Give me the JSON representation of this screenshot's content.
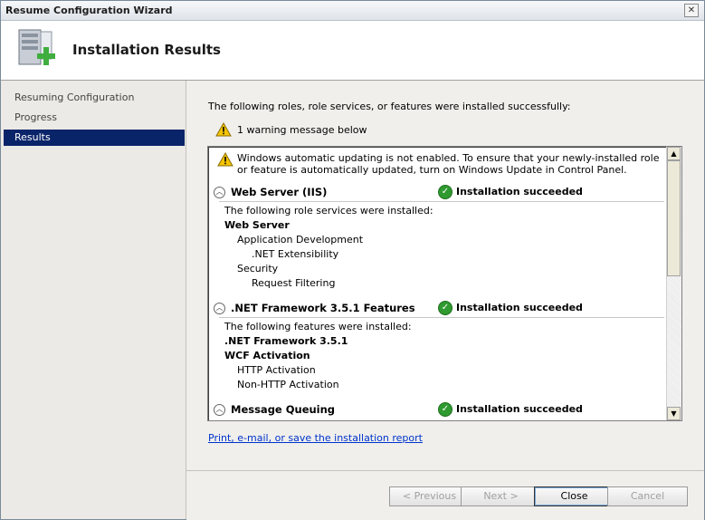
{
  "window": {
    "title": "Resume Configuration Wizard",
    "close_glyph": "✕"
  },
  "header": {
    "heading": "Installation Results"
  },
  "sidebar": {
    "steps": [
      {
        "label": "Resuming Configuration",
        "active": false
      },
      {
        "label": "Progress",
        "active": false
      },
      {
        "label": "Results",
        "active": true
      }
    ]
  },
  "content": {
    "intro": "The following roles, role services, or features were installed successfully:",
    "warning_summary": "1 warning message below",
    "notice": "Windows automatic updating is not enabled. To ensure that your newly-installed role or feature is automatically updated, turn on Windows Update in Control Panel.",
    "sections": [
      {
        "name": "Web Server (IIS)",
        "status": "Installation succeeded",
        "lines": [
          {
            "text": "The following role services were installed:",
            "bold": false,
            "indent": 0
          },
          {
            "text": "Web Server",
            "bold": true,
            "indent": 0
          },
          {
            "text": "Application Development",
            "bold": false,
            "indent": 1
          },
          {
            "text": ".NET Extensibility",
            "bold": false,
            "indent": 2
          },
          {
            "text": "Security",
            "bold": false,
            "indent": 1
          },
          {
            "text": "Request Filtering",
            "bold": false,
            "indent": 2
          }
        ]
      },
      {
        "name": ".NET Framework 3.5.1 Features",
        "status": "Installation succeeded",
        "lines": [
          {
            "text": "The following features were installed:",
            "bold": false,
            "indent": 0
          },
          {
            "text": ".NET Framework 3.5.1",
            "bold": true,
            "indent": 0
          },
          {
            "text": "WCF Activation",
            "bold": true,
            "indent": 0
          },
          {
            "text": "HTTP Activation",
            "bold": false,
            "indent": 1
          },
          {
            "text": "Non-HTTP Activation",
            "bold": false,
            "indent": 1
          }
        ]
      },
      {
        "name": "Message Queuing",
        "status": "Installation succeeded",
        "lines": []
      }
    ],
    "report_link": "Print, e-mail, or save the installation report"
  },
  "footer": {
    "previous": "< Previous",
    "next": "Next >",
    "close": "Close",
    "cancel": "Cancel"
  },
  "colors": {
    "selected_step": "#0a246a",
    "success": "#2f9a2f",
    "warning": "#f5c400",
    "link": "#0033cc"
  }
}
